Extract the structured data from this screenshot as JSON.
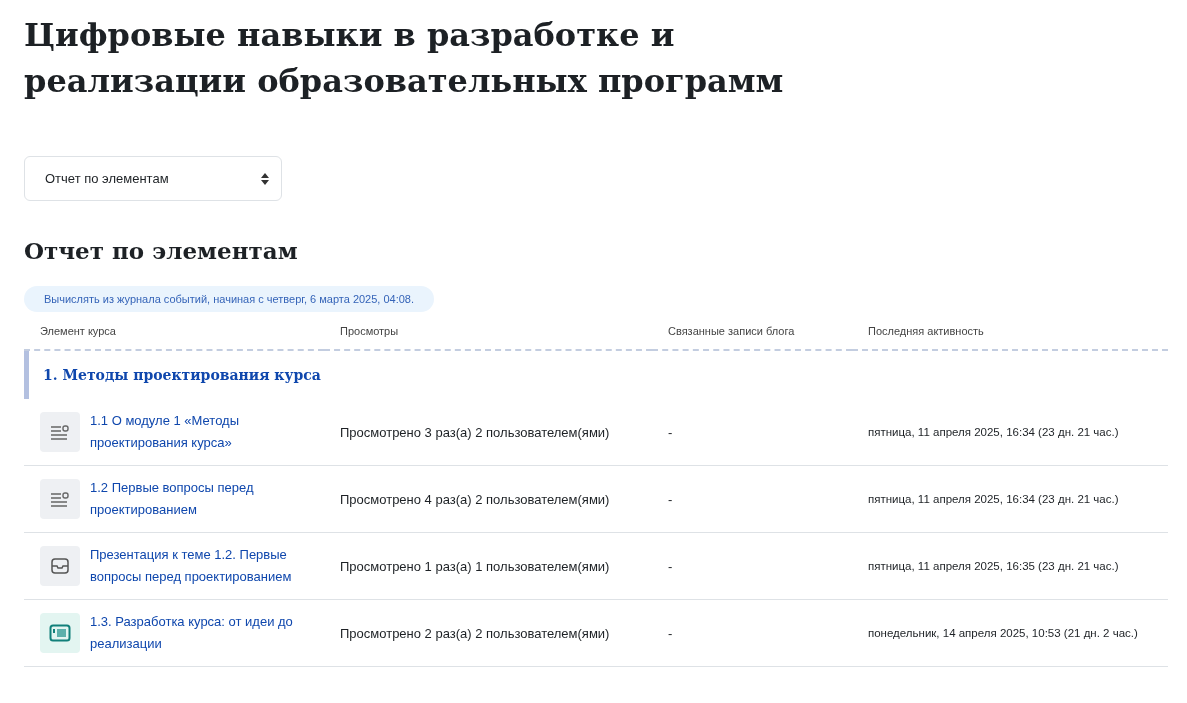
{
  "title": "Цифровые навыки в разработке и реализации образовательных программ",
  "report_select": {
    "value": "Отчет по элементам"
  },
  "report_heading": "Отчет по элементам",
  "info_note": "Вычислять из журнала событий, начиная с четверг, 6 марта 2025, 04:08.",
  "table": {
    "columns": [
      "Элемент курса",
      "Просмотры",
      "Связанные записи блога",
      "Последняя активность"
    ],
    "section": "1. Методы проектирования курса",
    "rows": [
      {
        "kind": "page",
        "name": "1.1 О модуле 1 «Методы проектирования курса»",
        "views": "Просмотрено 3 раз(а) 2 пользователем(ями)",
        "blog": "-",
        "last": "пятница, 11 апреля 2025, 16:34 (23 дн. 21 час.)"
      },
      {
        "kind": "page",
        "name": "1.2 Первые вопросы перед проектированием",
        "views": "Просмотрено 4 раз(а) 2 пользователем(ями)",
        "blog": "-",
        "last": "пятница, 11 апреля 2025, 16:34 (23 дн. 21 час.)"
      },
      {
        "kind": "resource",
        "name": "Презентация к теме 1.2. Первые вопросы перед проектированием",
        "views": "Просмотрено 1 раз(а) 1 пользователем(ями)",
        "blog": "-",
        "last": "пятница, 11 апреля 2025, 16:35 (23 дн. 21 час.)"
      },
      {
        "kind": "interactive",
        "name": "1.3. Разработка курса: от идеи до реализации",
        "views": "Просмотрено 2 раз(а) 2 пользователем(ями)",
        "blog": "-",
        "last": "понедельник, 14 апреля 2025, 10:53 (21 дн. 2 час.)"
      }
    ]
  }
}
